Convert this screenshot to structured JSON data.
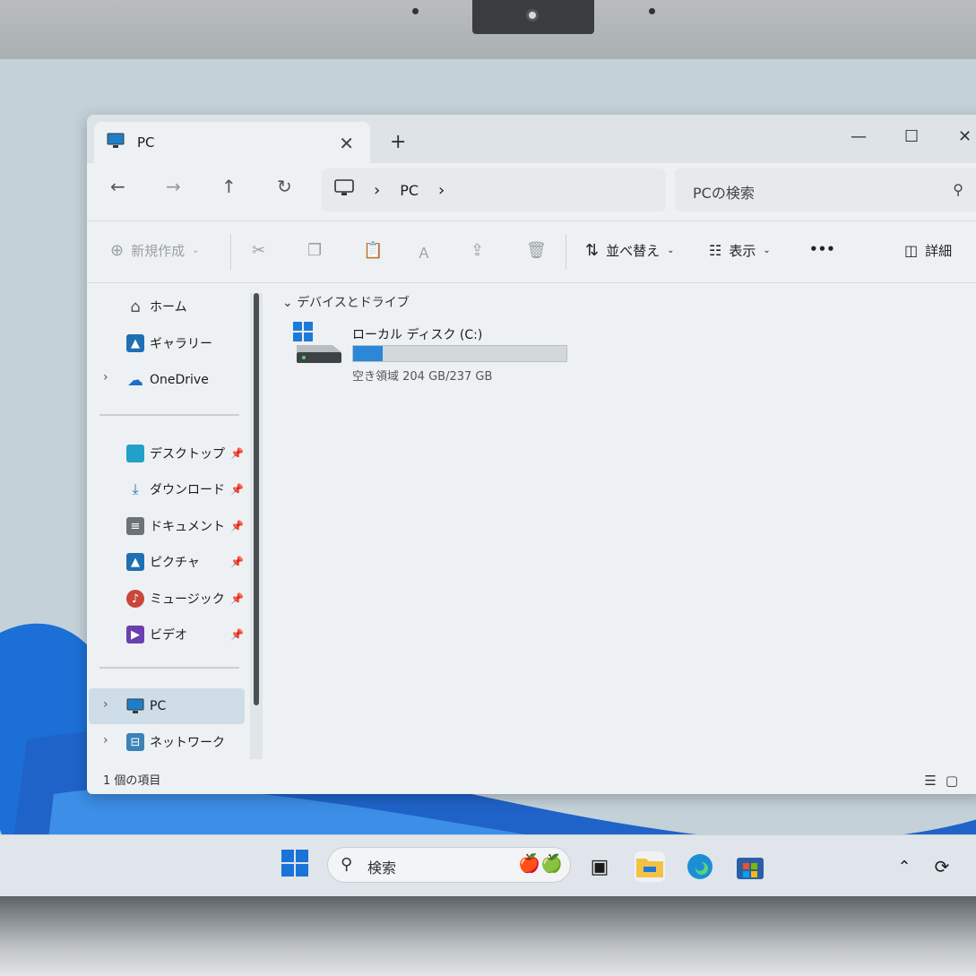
{
  "window": {
    "tab_title": "PC",
    "tab_close": "✕",
    "new_tab": "+",
    "minimize": "—",
    "maximize": "☐",
    "close": "✕"
  },
  "nav": {
    "back": "←",
    "forward": "→",
    "up": "↑",
    "refresh": "↻",
    "breadcrumb": "PC",
    "chevron": "›",
    "search_placeholder": "PCの検索",
    "search_icon": "⚲"
  },
  "toolbar": {
    "new_label": "新規作成",
    "sort_label": "並べ替え",
    "view_label": "表示",
    "more": "•••",
    "details_label": "詳細"
  },
  "sidebar": {
    "home": "ホーム",
    "gallery": "ギャラリー",
    "onedrive": "OneDrive",
    "desktop": "デスクトップ",
    "downloads": "ダウンロード",
    "documents": "ドキュメント",
    "pictures": "ピクチャ",
    "music": "ミュージック",
    "videos": "ビデオ",
    "pc": "PC",
    "network": "ネットワーク"
  },
  "main": {
    "group_header": "デバイスとドライブ",
    "drive_name": "ローカル ディスク (C:)",
    "drive_free": "空き領域 204 GB/237 GB",
    "drive_used_fraction": 0.139
  },
  "status": {
    "items_count": "1 個の項目"
  },
  "taskbar": {
    "search_placeholder": "検索"
  },
  "colors": {
    "accent": "#2b88d8",
    "selection": "#cfdde8"
  }
}
